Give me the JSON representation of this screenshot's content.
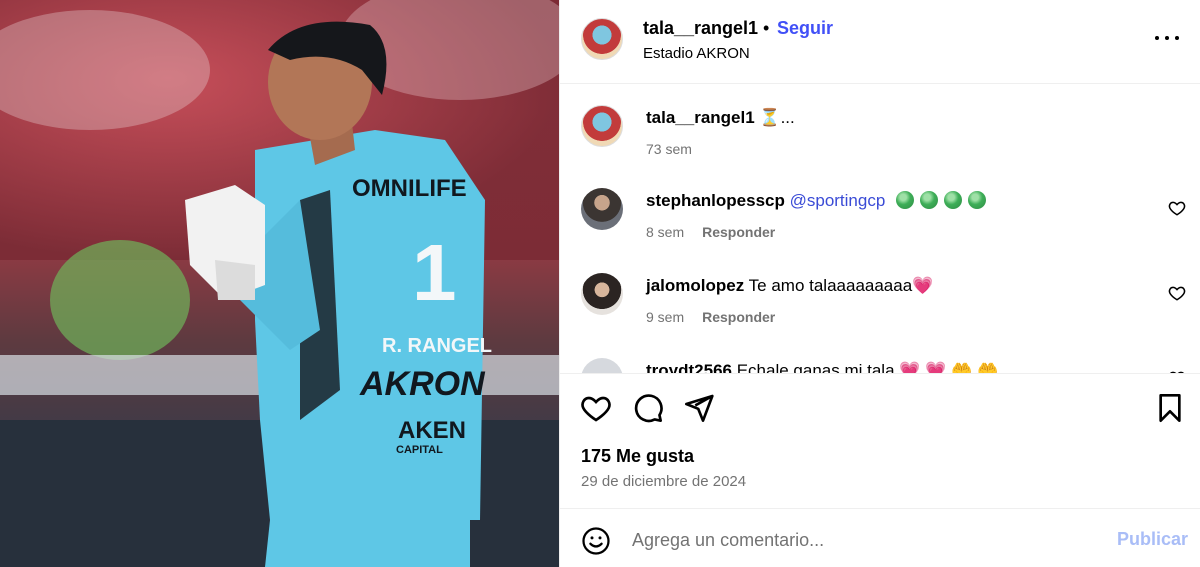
{
  "post": {
    "owner": "tala__rangel1",
    "separator": "•",
    "follow_label": "Seguir",
    "location": "Estadio AKRON",
    "more_icon": "more-horizontal-icon"
  },
  "photo": {
    "jersey_sponsor": "OMNILIFE",
    "jersey_number": "1",
    "jersey_name": "R. RANGEL",
    "jersey_akron": "AKRON",
    "jersey_aken": "AKEN",
    "jersey_capital": "CAPITAL",
    "jersey_color": "#5ec7e6"
  },
  "caption": {
    "user": "tala__rangel1",
    "text": "⏳...",
    "time": "73 sem"
  },
  "comments": [
    {
      "user": "stephanlopesscp",
      "mention": "@sportingcp",
      "text": "",
      "emoji_count": 4,
      "time": "8 sem",
      "reply_label": "Responder"
    },
    {
      "user": "jalomolopez",
      "mention": "",
      "text": "Te amo talaaaaaaaaa",
      "emoji": "💗",
      "time": "9 sem",
      "reply_label": "Responder"
    },
    {
      "user": "troydt2566",
      "mention": "",
      "text": "Echale ganas mi tala",
      "emoji": "💗 💗 🤲 🤲",
      "time": "",
      "reply_label": ""
    }
  ],
  "actions": {
    "likes": "175 Me gusta",
    "date": "29 de diciembre de 2024"
  },
  "composer": {
    "placeholder": "Agrega un comentario...",
    "publish_label": "Publicar"
  },
  "colors": {
    "accent": "#4150f7",
    "publish_disabled": "#a9bdf7",
    "muted": "#737373"
  }
}
